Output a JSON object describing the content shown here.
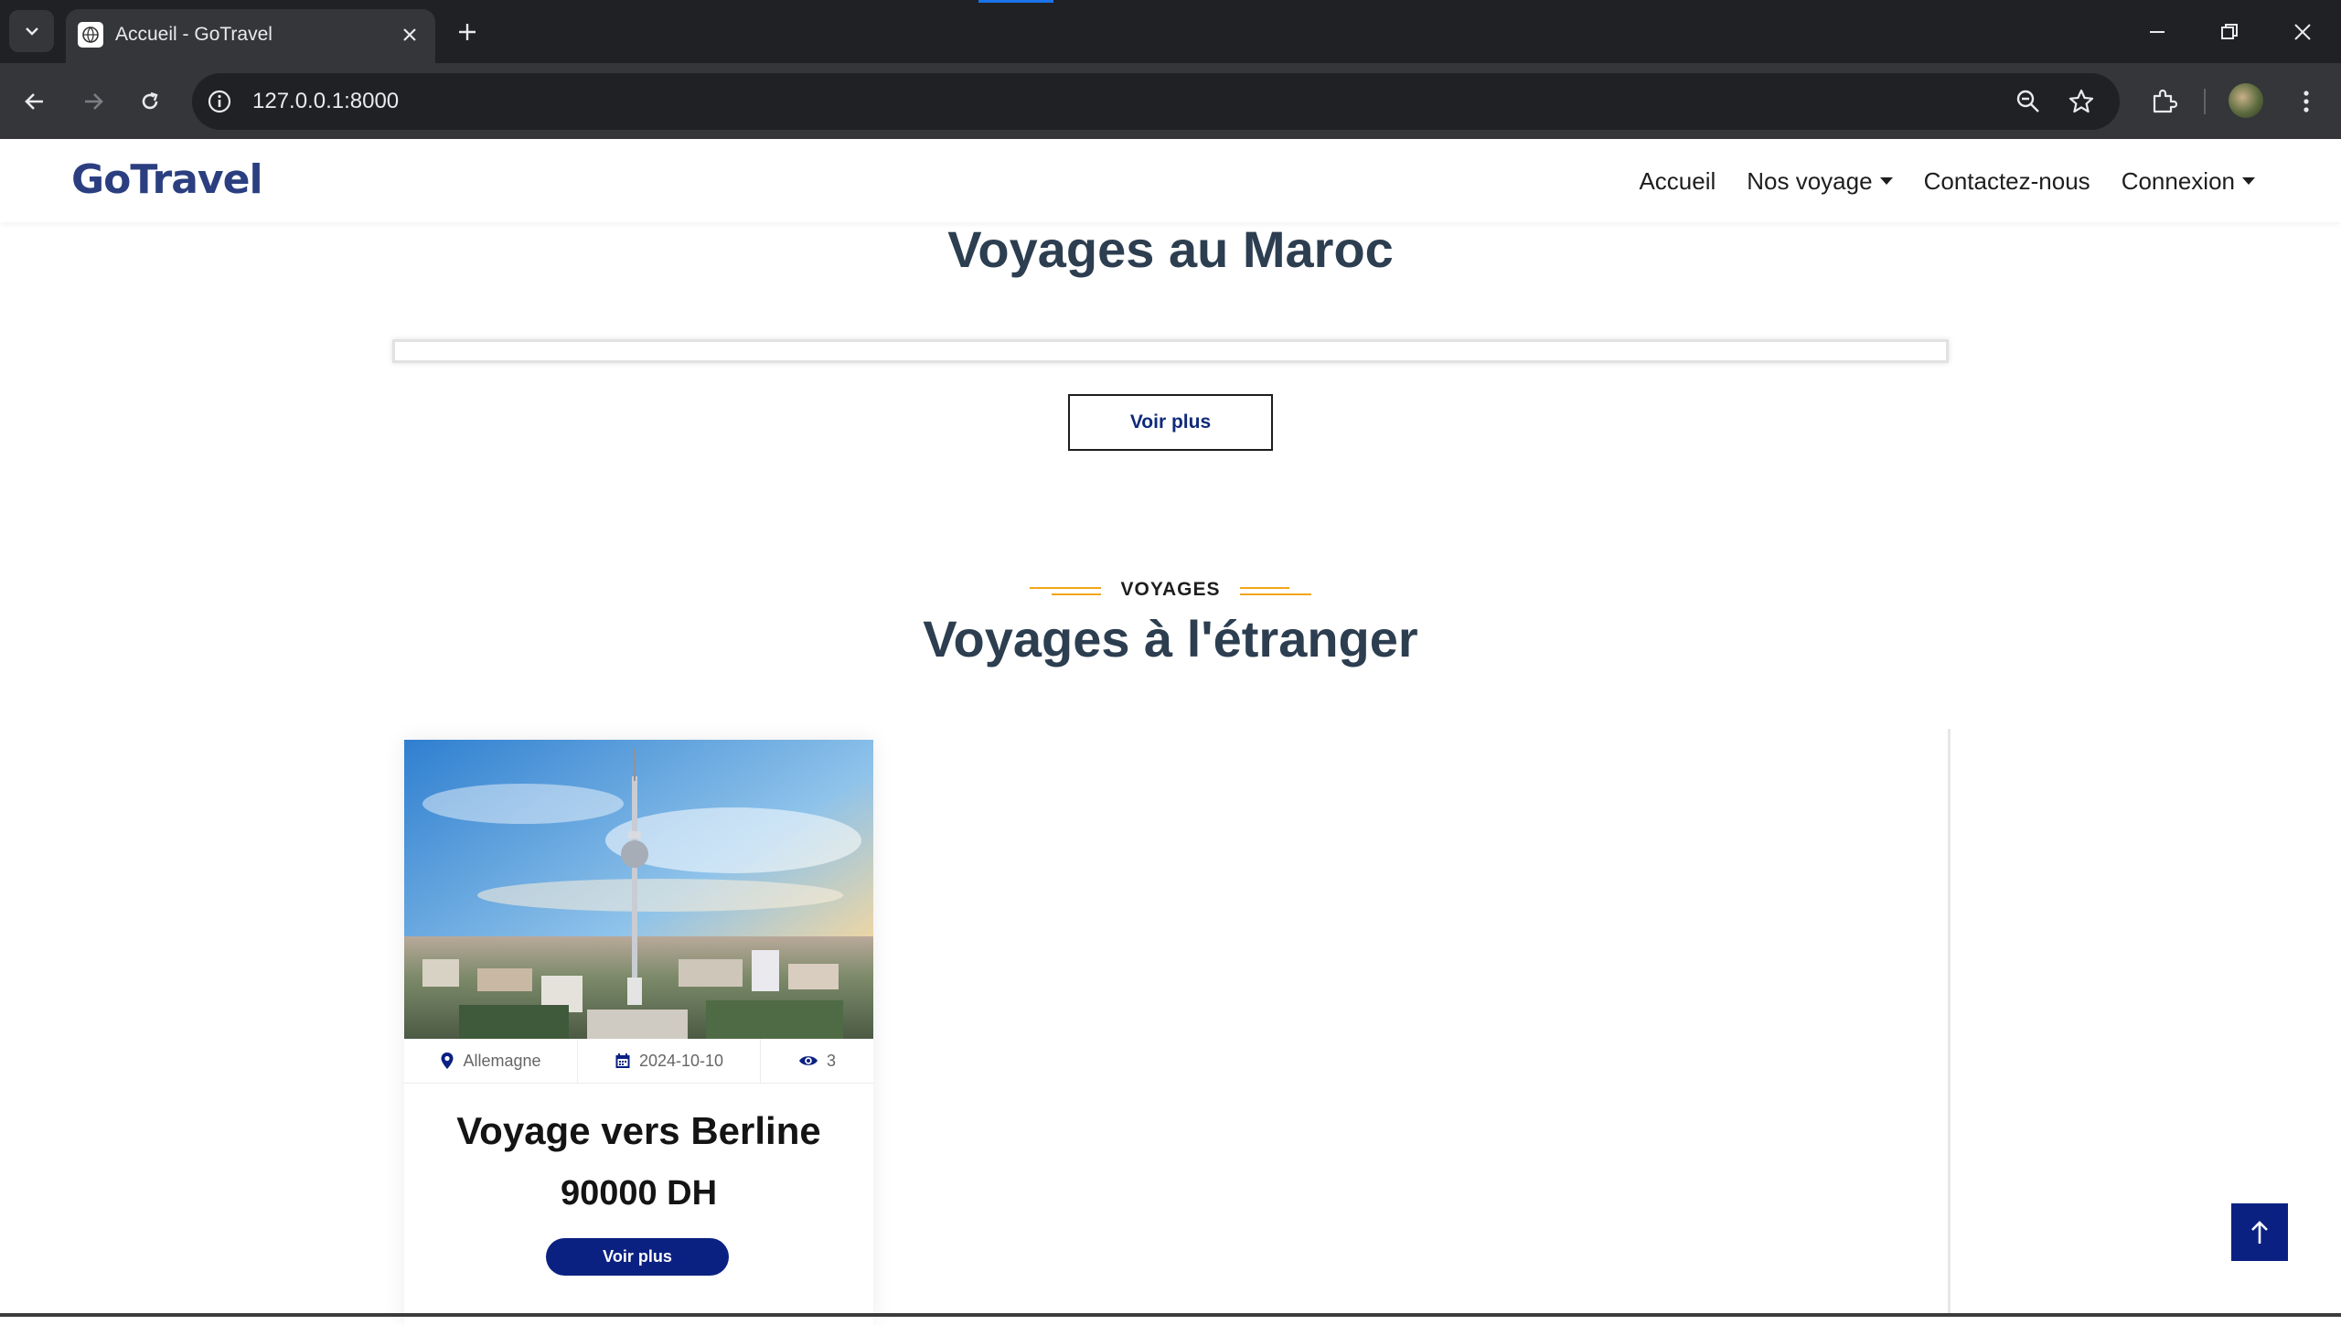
{
  "browser": {
    "tab_title": "Accueil - GoTravel",
    "url": "127.0.0.1:8000"
  },
  "site": {
    "logo": "GoTravel",
    "nav": [
      {
        "label": "Accueil"
      },
      {
        "label": "Nos voyage"
      },
      {
        "label": "Contactez-nous"
      },
      {
        "label": "Connexion"
      }
    ]
  },
  "maroc_section": {
    "title": "Voyages au Maroc",
    "button": "Voir plus"
  },
  "etranger_section": {
    "kicker": "VOYAGES",
    "title": "Voyages à l'étranger",
    "card": {
      "country": "Allemagne",
      "date": "2024-10-10",
      "views": "3",
      "title": "Voyage vers Berline",
      "price": "90000 DH",
      "button": "Voir plus"
    }
  },
  "colors": {
    "brand_navy": "#0b2182",
    "heading": "#2c3e50",
    "accent_orange": "#f2a516"
  }
}
